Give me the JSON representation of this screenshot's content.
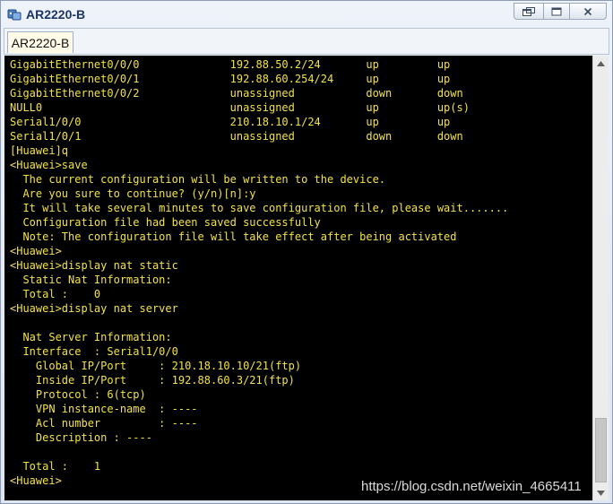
{
  "window": {
    "title": "AR2220-B",
    "icon": "router-app-icon",
    "controls": [
      "restore-icon",
      "minimize-icon",
      "close-icon"
    ]
  },
  "tabs": [
    {
      "label": "AR2220-B",
      "active": true
    }
  ],
  "terminal": {
    "lines": [
      "GigabitEthernet0/0/0              192.88.50.2/24       up         up",
      "GigabitEthernet0/0/1              192.88.60.254/24     up         up",
      "GigabitEthernet0/0/2              unassigned           down       down",
      "NULL0                             unassigned           up         up(s)",
      "Serial1/0/0                       210.18.10.1/24       up         up",
      "Serial1/0/1                       unassigned           down       down",
      "[Huawei]q",
      "<Huawei>save",
      "  The current configuration will be written to the device.",
      "  Are you sure to continue? (y/n)[n]:y",
      "  It will take several minutes to save configuration file, please wait.......",
      "  Configuration file had been saved successfully",
      "  Note: The configuration file will take effect after being activated",
      "<Huawei>",
      "<Huawei>display nat static",
      "  Static Nat Information:",
      "  Total :    0",
      "<Huawei>display nat server",
      "",
      "  Nat Server Information:",
      "  Interface  : Serial1/0/0",
      "    Global IP/Port     : 210.18.10.10/21(ftp)",
      "    Inside IP/Port     : 192.88.60.3/21(ftp)",
      "    Protocol : 6(tcp)",
      "    VPN instance-name  : ----",
      "    Acl number         : ----",
      "    Description : ----",
      "",
      "  Total :    1",
      "<Huawei>"
    ],
    "text_color": "#f2e24a",
    "background": "#000000"
  },
  "watermark": "https://blog.csdn.net/weixin_4665411"
}
